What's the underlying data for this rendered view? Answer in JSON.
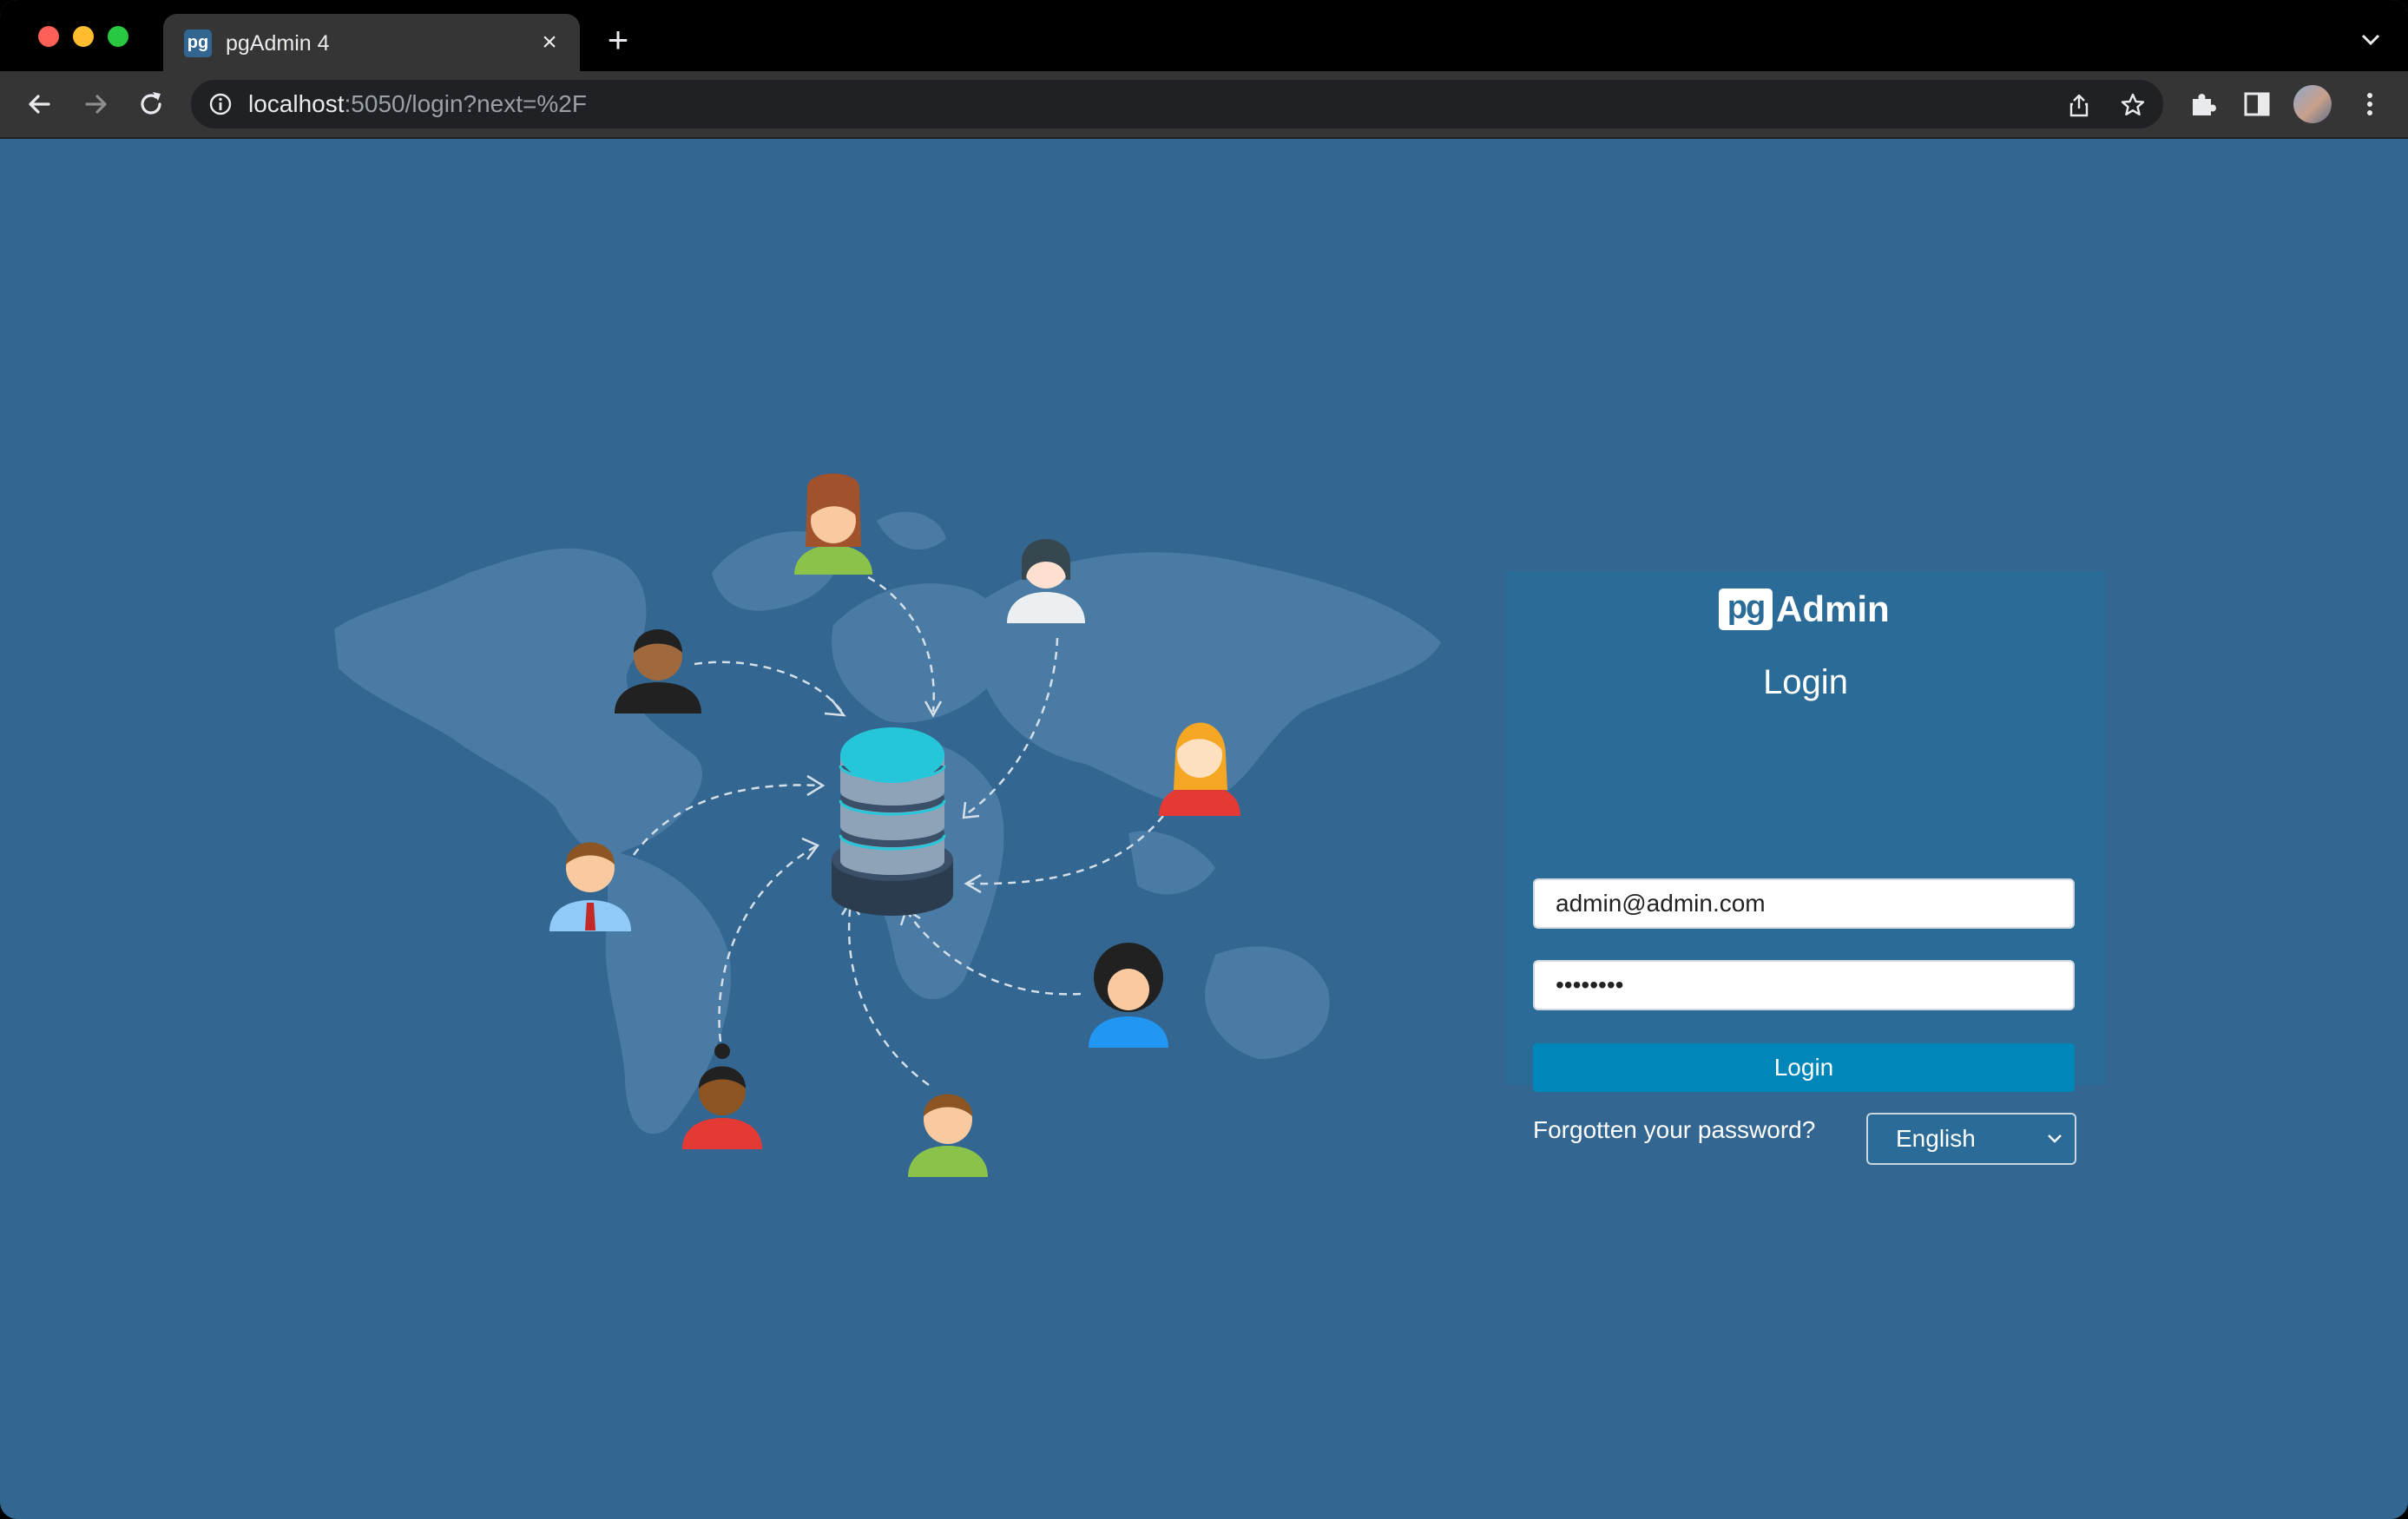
{
  "browser": {
    "tab_title": "pgAdmin 4",
    "tab_favicon": "pg",
    "url_host": "localhost",
    "url_rest": ":5050/login?next=%2F"
  },
  "icons": {
    "back": "arrow-left-icon",
    "forward": "arrow-right-icon",
    "reload": "reload-icon",
    "info": "info-icon",
    "share": "share-icon",
    "bookmark": "star-icon",
    "extensions": "puzzle-icon",
    "sidepanel": "side-panel-icon",
    "menu": "kebab-menu-icon"
  },
  "colors": {
    "page_bg": "#336690",
    "card_bg": "#2a6b97",
    "button_bg": "#0086b8"
  },
  "login": {
    "logo_pg": "pg",
    "logo_admin": "Admin",
    "heading": "Login",
    "email_value": "admin@admin.com",
    "password_value": "••••••••",
    "button_label": "Login",
    "forgot_link": "Forgotten your password?",
    "language": "English"
  }
}
